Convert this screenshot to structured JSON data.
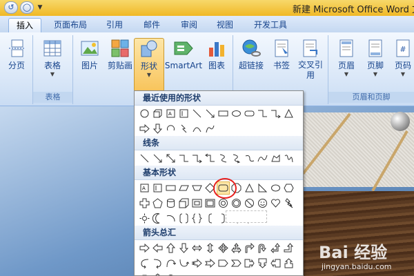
{
  "title_bar": {
    "title": "新建 Microsoft Office Word 文",
    "undo_icon": "undo-icon",
    "customize_icon": "dropdown-icon"
  },
  "tabs": [
    {
      "label": "插入",
      "active": true
    },
    {
      "label": "页面布局"
    },
    {
      "label": "引用"
    },
    {
      "label": "邮件"
    },
    {
      "label": "审阅"
    },
    {
      "label": "视图"
    },
    {
      "label": "开发工具"
    }
  ],
  "ribbon": {
    "groups": [
      {
        "name": "",
        "buttons": [
          {
            "label": "分页",
            "icon": "page-break-icon"
          }
        ]
      },
      {
        "name": "表格",
        "buttons": [
          {
            "label": "表格",
            "icon": "table-icon"
          }
        ]
      },
      {
        "name": "",
        "buttons": [
          {
            "label": "图片",
            "icon": "picture-icon"
          },
          {
            "label": "剪贴画",
            "icon": "clipart-icon"
          },
          {
            "label": "形状",
            "icon": "shapes-icon",
            "pressed": true
          },
          {
            "label": "SmartArt",
            "icon": "smartart-icon"
          },
          {
            "label": "图表",
            "icon": "chart-icon"
          }
        ]
      },
      {
        "name": "",
        "buttons": [
          {
            "label": "超链接",
            "icon": "hyperlink-icon"
          },
          {
            "label": "书签",
            "icon": "bookmark-icon"
          },
          {
            "label": "交叉引用",
            "icon": "cross-reference-icon"
          }
        ]
      },
      {
        "name": "页眉和页脚",
        "buttons": [
          {
            "label": "页眉",
            "icon": "header-icon"
          },
          {
            "label": "页脚",
            "icon": "footer-icon"
          },
          {
            "label": "页码",
            "icon": "page-number-icon"
          }
        ]
      }
    ]
  },
  "shapes_menu": {
    "sections": [
      {
        "title": "最近使用的形状"
      },
      {
        "title": "线条"
      },
      {
        "title": "基本形状"
      },
      {
        "title": "箭头总汇"
      }
    ]
  },
  "watermark": {
    "text": "Bai 经验",
    "url": "jingyan.baidu.com"
  },
  "colors": {
    "accent_highlight": "#e8201e",
    "ribbon_text": "#15428b",
    "title_bar": "#f0b825"
  }
}
